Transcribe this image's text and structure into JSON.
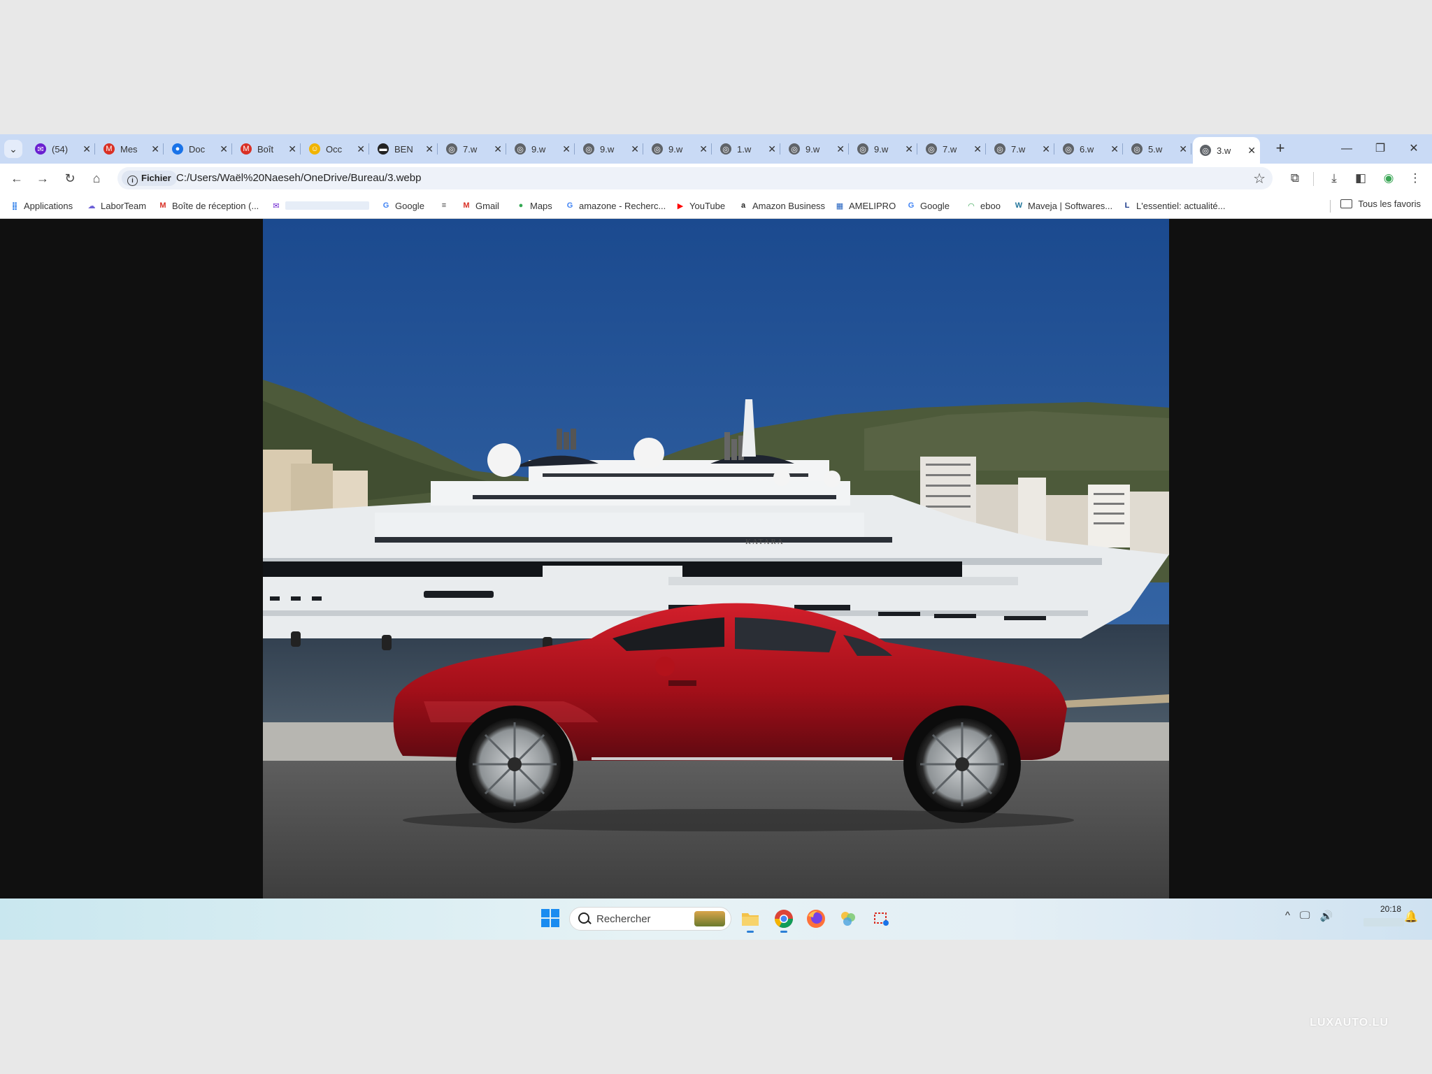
{
  "tabs": [
    {
      "label": "(54)",
      "icon": "mail-icon",
      "color": "#6a1fd0"
    },
    {
      "label": "Mes",
      "icon": "gmail-icon",
      "color": "#d93025"
    },
    {
      "label": "Doc",
      "icon": "maps-pin-icon",
      "color": "#1a73e8"
    },
    {
      "label": "Boît",
      "icon": "gmail-icon",
      "color": "#d93025"
    },
    {
      "label": "Occ",
      "icon": "smiley-icon",
      "color": "#f1b400"
    },
    {
      "label": "BEN",
      "icon": "flag-icon",
      "color": "#222222"
    },
    {
      "label": "7.w",
      "icon": "globe-icon",
      "color": "#5f6368"
    },
    {
      "label": "9.w",
      "icon": "globe-icon",
      "color": "#5f6368"
    },
    {
      "label": "9.w",
      "icon": "globe-icon",
      "color": "#5f6368"
    },
    {
      "label": "9.w",
      "icon": "globe-icon",
      "color": "#5f6368"
    },
    {
      "label": "1.w",
      "icon": "globe-icon",
      "color": "#5f6368"
    },
    {
      "label": "9.w",
      "icon": "globe-icon",
      "color": "#5f6368"
    },
    {
      "label": "9.w",
      "icon": "globe-icon",
      "color": "#5f6368"
    },
    {
      "label": "7.w",
      "icon": "globe-icon",
      "color": "#5f6368"
    },
    {
      "label": "7.w",
      "icon": "globe-icon",
      "color": "#5f6368"
    },
    {
      "label": "6.w",
      "icon": "globe-icon",
      "color": "#5f6368"
    },
    {
      "label": "5.w",
      "icon": "globe-icon",
      "color": "#5f6368"
    },
    {
      "label": "3.w",
      "icon": "globe-icon",
      "color": "#5f6368",
      "active": true
    }
  ],
  "toolbar": {
    "chip_label": "Fichier",
    "url": "C:/Users/Waël%20Naeseh/OneDrive/Bureau/3.webp"
  },
  "bookmarks": [
    {
      "label": "Applications",
      "icon": "apps-grid-icon",
      "color": "#1a73e8"
    },
    {
      "label": "LaborTeam",
      "icon": "cloud-icon",
      "color": "#6b5fd6"
    },
    {
      "label": "Boîte de réception (...",
      "icon": "gmail-icon",
      "color": "#d93025"
    },
    {
      "label": "",
      "icon": "mail-icon",
      "color": "#6a1fd0"
    },
    {
      "label": "Google",
      "icon": "google-icon",
      "color": "#4285f4"
    },
    {
      "label": "",
      "icon": "menu-lines-icon",
      "color": "#444444"
    },
    {
      "label": "Gmail",
      "icon": "gmail-icon",
      "color": "#d93025"
    },
    {
      "label": "Maps",
      "icon": "maps-pin-icon",
      "color": "#34a853"
    },
    {
      "label": "amazone - Recherc...",
      "icon": "google-icon",
      "color": "#4285f4"
    },
    {
      "label": "YouTube",
      "icon": "youtube-icon",
      "color": "#ff0000"
    },
    {
      "label": "Amazon Business",
      "icon": "amazon-icon",
      "color": "#222222"
    },
    {
      "label": "AMELIPRO",
      "icon": "grid-icon",
      "color": "#1f5fbf"
    },
    {
      "label": "Google",
      "icon": "google-icon",
      "color": "#4285f4"
    },
    {
      "label": "eboo",
      "icon": "arc-icon",
      "color": "#3aa655"
    },
    {
      "label": "Maveja | Softwares...",
      "icon": "wordpress-icon",
      "color": "#21759b"
    },
    {
      "label": "L'essentiel: actualité...",
      "icon": "l-logo-icon",
      "color": "#1b3a8a"
    }
  ],
  "all_favorites": "Tous les favoris",
  "photo": {
    "yacht_name": "KATARA",
    "colors": {
      "sky": "#1f4e93",
      "sea": "#3b4a5a",
      "car": "#b5121b",
      "yacht": "#e9ecee"
    }
  },
  "taskbar": {
    "search_placeholder": "Rechercher",
    "time": "20:18",
    "apps": [
      "file-explorer-icon",
      "chrome-icon",
      "firefox-icon",
      "photos-icon",
      "snipping-tool-icon"
    ]
  },
  "watermark": "LUXAUTO.LU"
}
